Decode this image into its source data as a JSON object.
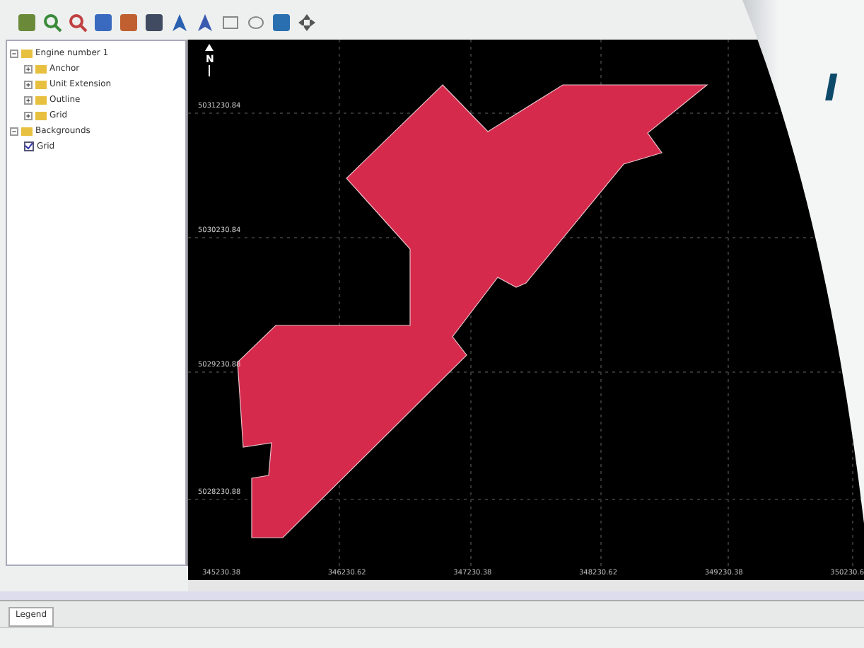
{
  "layer_tree": [
    {
      "label": "Engine number 1",
      "kind": "group",
      "expanded": true,
      "children": [
        {
          "label": "Anchor",
          "kind": "folder"
        },
        {
          "label": "Unit Extension",
          "kind": "folder"
        },
        {
          "label": "Outline",
          "kind": "folder"
        },
        {
          "label": "Grid",
          "kind": "folder"
        }
      ]
    },
    {
      "label": "Backgrounds",
      "kind": "group",
      "expanded": true,
      "children": [
        {
          "label": "Grid",
          "kind": "checkbox",
          "checked": true
        }
      ]
    }
  ],
  "map": {
    "north_label": "N",
    "y_labels": [
      "5031230.84",
      "5030230.84",
      "5029230.88",
      "5028230.88"
    ],
    "x_labels": [
      "345230.38",
      "346230.62",
      "347230.38",
      "348230.62",
      "349230.38",
      "350230.6"
    ]
  },
  "bottom_panel": {
    "tabs": [
      {
        "label": "Legend",
        "selected": true
      }
    ]
  },
  "overlay_text": "I"
}
